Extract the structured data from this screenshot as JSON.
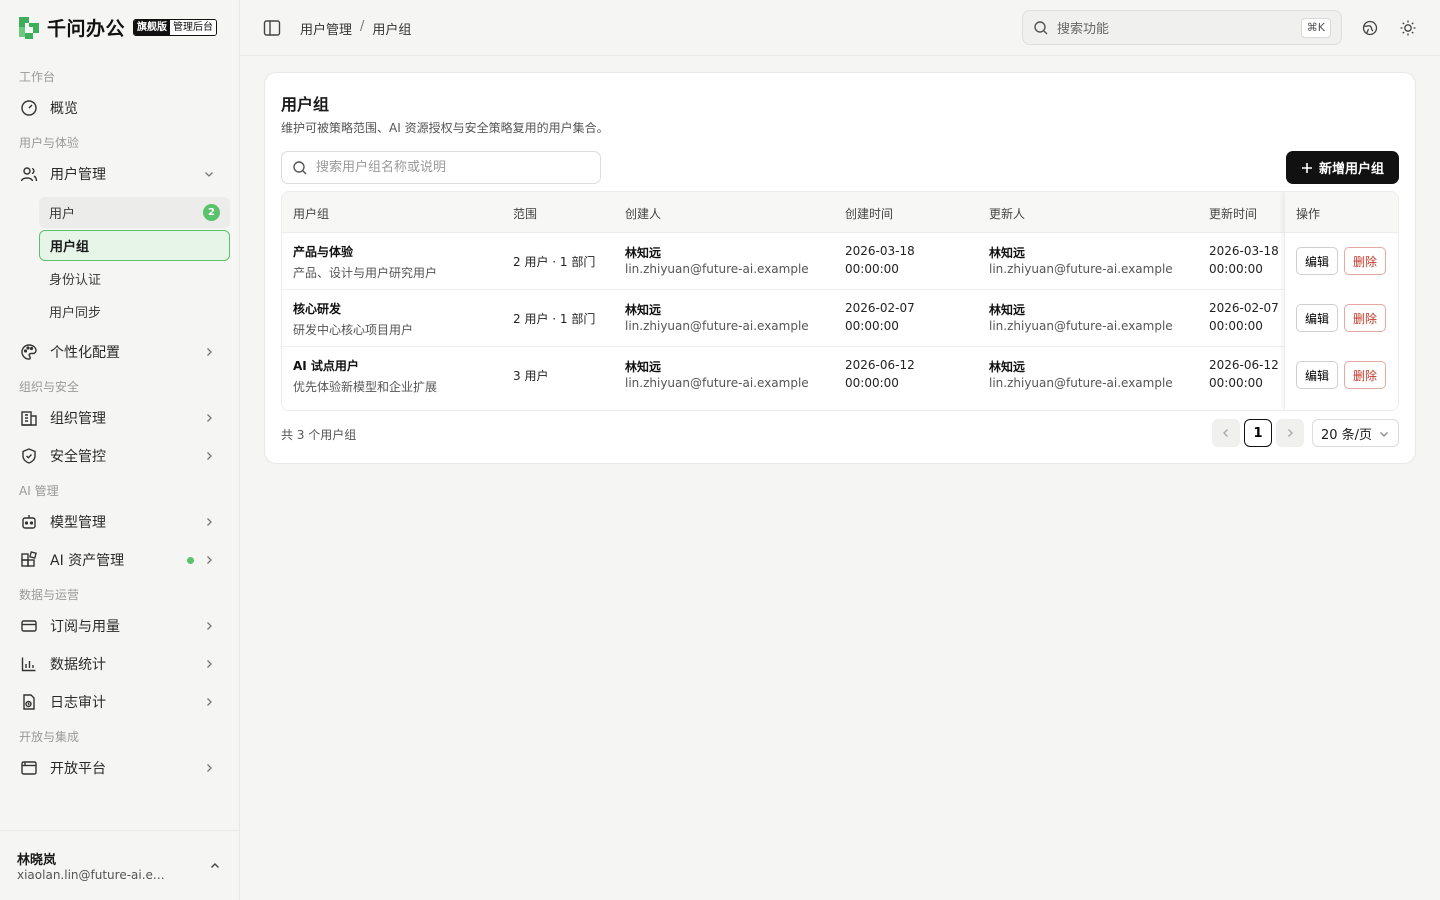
{
  "brand": {
    "name": "千问办公",
    "edition": "旗舰版",
    "console": "管理后台",
    "logo_color": "#3fae5c"
  },
  "sidebar": {
    "sections": {
      "workbench": "工作台",
      "users_exp": "用户与体验",
      "org_sec": "组织与安全",
      "ai_mgmt": "AI 管理",
      "data_ops": "数据与运营",
      "open_int": "开放与集成"
    },
    "items": {
      "overview": "概览",
      "user_mgmt": "用户管理",
      "personalize": "个性化配置",
      "org_mgmt": "组织管理",
      "security": "安全管控",
      "model_mgmt": "模型管理",
      "ai_assets": "AI 资产管理",
      "subscription": "订阅与用量",
      "statistics": "数据统计",
      "audit_log": "日志审计",
      "open_platform": "开放平台"
    },
    "sub_items": {
      "users": "用户",
      "users_count": "2",
      "user_groups": "用户组",
      "identity": "身份认证",
      "user_sync": "用户同步"
    },
    "current_user": {
      "name": "林晓岚",
      "email": "xiaolan.lin@future-ai.example"
    }
  },
  "header": {
    "breadcrumb": [
      "用户管理",
      "用户组"
    ],
    "breadcrumb_sep": "/",
    "search_placeholder": "搜索功能",
    "search_shortcut": "⌘K"
  },
  "page": {
    "title": "用户组",
    "description": "维护可被策略范围、AI 资源授权与安全策略复用的用户集合。",
    "filter_placeholder": "搜索用户组名称或说明",
    "add_button": "新增用户组",
    "columns": [
      "用户组",
      "范围",
      "创建人",
      "创建时间",
      "更新人",
      "更新时间",
      "操作"
    ],
    "rows": [
      {
        "name": "产品与体验",
        "desc": "产品、设计与用户研究用户",
        "scope": "2 用户 · 1 部门",
        "creator": "林知远",
        "creator_email": "lin.zhiyuan@future-ai.example",
        "created_date": "2026-03-18",
        "created_time": "00:00:00",
        "updater": "林知远",
        "updater_email": "lin.zhiyuan@future-ai.example",
        "updated_date": "2026-03-18",
        "updated_time": "00:00:00"
      },
      {
        "name": "核心研发",
        "desc": "研发中心核心项目用户",
        "scope": "2 用户 · 1 部门",
        "creator": "林知远",
        "creator_email": "lin.zhiyuan@future-ai.example",
        "created_date": "2026-02-07",
        "created_time": "00:00:00",
        "updater": "林知远",
        "updater_email": "lin.zhiyuan@future-ai.example",
        "updated_date": "2026-02-07",
        "updated_time": "00:00:00"
      },
      {
        "name": "AI 试点用户",
        "desc": "优先体验新模型和企业扩展",
        "scope": "3 用户",
        "creator": "林知远",
        "creator_email": "lin.zhiyuan@future-ai.example",
        "created_date": "2026-06-12",
        "created_time": "00:00:00",
        "updater": "林知远",
        "updater_email": "lin.zhiyuan@future-ai.example",
        "updated_date": "2026-06-12",
        "updated_time": "00:00:00"
      }
    ],
    "edit_label": "编辑",
    "delete_label": "删除",
    "total_text": "共 3 个用户组",
    "current_page": "1",
    "page_size": "20 条/页"
  },
  "colors": {
    "accent_green": "#5ac26a",
    "danger": "#c0392b",
    "primary": "#111111"
  }
}
